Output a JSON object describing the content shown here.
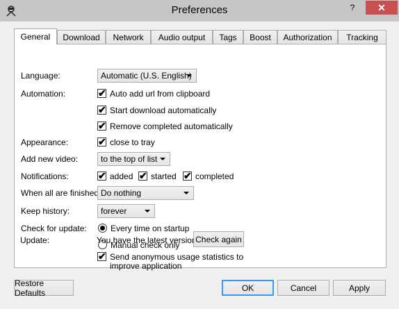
{
  "window": {
    "title": "Preferences",
    "help_glyph": "?",
    "close_glyph": "✕"
  },
  "tabs": [
    {
      "label": "General"
    },
    {
      "label": "Download"
    },
    {
      "label": "Network"
    },
    {
      "label": "Audio output"
    },
    {
      "label": "Tags"
    },
    {
      "label": "Boost"
    },
    {
      "label": "Authorization"
    },
    {
      "label": "Tracking"
    }
  ],
  "general": {
    "language_label": "Language:",
    "language_value": "Automatic (U.S. English)",
    "automation_label": "Automation:",
    "auto_add": {
      "label": "Auto add url from clipboard",
      "checked": true
    },
    "start_download": {
      "label": "Start download automatically",
      "checked": true
    },
    "remove_completed": {
      "label": "Remove completed automatically",
      "checked": true
    },
    "appearance_label": "Appearance:",
    "close_to_tray": {
      "label": "close to tray",
      "checked": true
    },
    "add_new_video_label": "Add new video:",
    "add_new_video_value": "to the top of list",
    "notifications_label": "Notifications:",
    "notif_added": {
      "label": "added",
      "checked": true
    },
    "notif_started": {
      "label": "started",
      "checked": true
    },
    "notif_completed": {
      "label": "completed",
      "checked": true
    },
    "when_finished_label": "When all are finished:",
    "when_finished_value": "Do nothing",
    "keep_history_label": "Keep history:",
    "keep_history_value": "forever",
    "check_update_label": "Check for update:",
    "update_every_time": {
      "label": "Every time on startup",
      "selected": true
    },
    "update_manual": {
      "label": "Manual check only",
      "selected": false
    },
    "update_label": "Update:",
    "update_status": "You have the latest version",
    "check_again_label": "Check again",
    "send_stats": {
      "label_line1": "Send anonymous usage statistics to",
      "label_line2": "improve application",
      "checked": true
    }
  },
  "footer": {
    "restore_defaults": "Restore Defaults",
    "ok": "OK",
    "cancel": "Cancel",
    "apply": "Apply"
  },
  "check_glyph": "✔"
}
